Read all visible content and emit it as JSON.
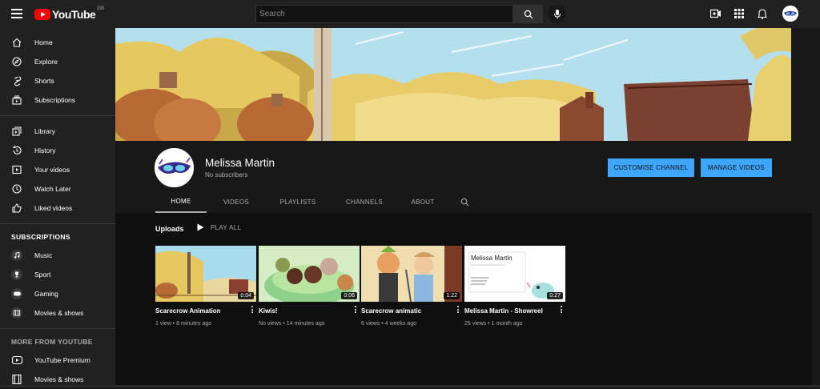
{
  "app": {
    "logo_text": "YouTube",
    "region": "GB",
    "search_placeholder": "Search"
  },
  "sidebar": {
    "main": [
      {
        "label": "Home",
        "icon": "home-icon"
      },
      {
        "label": "Explore",
        "icon": "compass-icon"
      },
      {
        "label": "Shorts",
        "icon": "shorts-icon"
      },
      {
        "label": "Subscriptions",
        "icon": "subscriptions-icon"
      }
    ],
    "library": [
      {
        "label": "Library",
        "icon": "library-icon"
      },
      {
        "label": "History",
        "icon": "history-icon"
      },
      {
        "label": "Your videos",
        "icon": "your-videos-icon"
      },
      {
        "label": "Watch Later",
        "icon": "clock-icon"
      },
      {
        "label": "Liked videos",
        "icon": "thumbs-up-icon"
      }
    ],
    "subscriptions_heading": "SUBSCRIPTIONS",
    "subscriptions": [
      {
        "label": "Music",
        "icon": "music-icon"
      },
      {
        "label": "Sport",
        "icon": "trophy-icon"
      },
      {
        "label": "Gaming",
        "icon": "gamepad-icon"
      },
      {
        "label": "Movies & shows",
        "icon": "film-icon"
      }
    ],
    "more_heading": "MORE FROM YOUTUBE",
    "more": [
      {
        "label": "YouTube Premium",
        "icon": "youtube-icon"
      },
      {
        "label": "Movies & shows",
        "icon": "film-icon"
      }
    ]
  },
  "channel": {
    "name": "Melissa Martin",
    "subscribers": "No subscribers",
    "customise_label": "CUSTOMISE CHANNEL",
    "manage_label": "MANAGE VIDEOS",
    "tabs": [
      "HOME",
      "VIDEOS",
      "PLAYLISTS",
      "CHANNELS",
      "ABOUT"
    ],
    "active_tab": "HOME"
  },
  "uploads": {
    "heading": "Uploads",
    "play_all": "PLAY ALL",
    "videos": [
      {
        "title": "Scarecrow Animation",
        "duration": "0:04",
        "meta": "1 view • 8 minutes ago"
      },
      {
        "title": "Kiwis!",
        "duration": "0:06",
        "meta": "No views • 14 minutes ago"
      },
      {
        "title": "Scarecrow animatic",
        "duration": "1:22",
        "meta": "6 views • 4 weeks ago"
      },
      {
        "title": "Melissa Martin - Showreel",
        "duration": "0:27",
        "meta": "25 views • 1 month ago",
        "thumb_title": "Melissa Martin"
      }
    ]
  },
  "colors": {
    "accent_blue": "#3ea6ff",
    "brand_red": "#ff0000",
    "bg_dark": "#181818"
  }
}
